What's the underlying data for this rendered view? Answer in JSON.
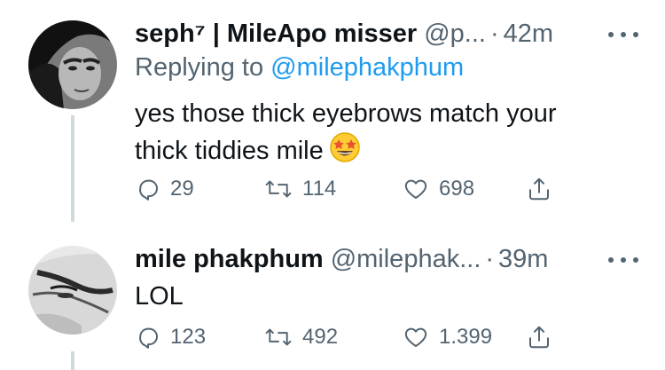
{
  "tweets": [
    {
      "display_name": "seph⁷ | MileApo misser",
      "handle": "@p...",
      "separator": "·",
      "time": "42m",
      "reply_prefix": "Replying to",
      "reply_to": "@milephakphum",
      "text_line1": "yes those thick eyebrows match your",
      "text_line2": "thick tiddies mile",
      "emoji": "star-struck-emoji",
      "counts": {
        "replies": "29",
        "retweets": "114",
        "likes": "698"
      }
    },
    {
      "display_name": "mile phakphum",
      "handle": "@milephak...",
      "separator": "·",
      "time": "39m",
      "text_line1": "LOL",
      "counts": {
        "replies": "123",
        "retweets": "492",
        "likes": "1.399"
      }
    }
  ],
  "icons": {
    "reply": "reply-icon",
    "retweet": "retweet-icon",
    "like": "heart-icon",
    "share": "share-icon",
    "more": "more-icon"
  },
  "colors": {
    "link": "#1d9bf0",
    "secondary_text": "#536471",
    "thread_line": "#cfd9de"
  }
}
